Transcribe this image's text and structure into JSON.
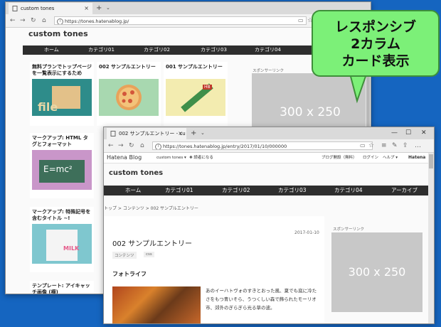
{
  "back_window": {
    "tab_title": "custom tones",
    "url": "https://tones.hatenablog.jp/",
    "blog_title": "custom tones",
    "menu": [
      "ホーム",
      "カテゴリ01",
      "カテゴリ02",
      "カテゴリ03",
      "カテゴリ04"
    ],
    "cards_row1": [
      {
        "title": "無料プランでトップページを一覧表示にするため",
        "thumb_text": "file"
      },
      {
        "title": "002 サンプルエントリー",
        "thumb_text": ""
      },
      {
        "title": "001 サンプルエントリー",
        "thumb_text": "HB"
      }
    ],
    "cards_col": [
      {
        "title": "マークアップ: HTML タグとフォーマット",
        "thumb_text": "E=mc²"
      },
      {
        "title": "マークアップ: 特殊記号を含むタイトル ~!",
        "thumb_text": "MILK"
      },
      {
        "title": "テンプレート: アイキャッチ画像 (横)",
        "thumb_text": ""
      }
    ],
    "sponsor_label": "スポンサーリンク",
    "ad_text": "300 x 250"
  },
  "front_window": {
    "tab_title": "002 サンプルエントリー - cu",
    "url": "https://tones.hatenablog.jp/entry/2017/01/10/000000",
    "hatena_logo": "Hatena Blog",
    "hatena_bar": {
      "blog_name": "custom tones ▾",
      "subscribe": "✚ 読者になる",
      "start_blog": "ブログ開設（無料）",
      "login": "ログイン",
      "help": "ヘルプ ▾",
      "hatena": "Hatena"
    },
    "blog_title": "custom tones",
    "menu": [
      "ホーム",
      "カテゴリ01",
      "カテゴリ02",
      "カテゴリ03",
      "カテゴリ04",
      "アーカイブ"
    ],
    "breadcrumb": "トップ  >  コンテンツ  >  002 サンプルエントリー",
    "entry_date": "2017-01-10",
    "entry_title": "002 サンプルエントリー",
    "tags": [
      "コンテンツ",
      "css"
    ],
    "section_heading": "フォトライフ",
    "body_text": "あのイーハトヴォのすきとおった風、夏でも底に冷たさをもつ青いそら、うつくしい森で飾られたモーリオ市、郊外のぎらぎら光る草の波。",
    "sponsor_label": "スポンサーリンク",
    "ad_text": "300 x 250"
  },
  "callout": {
    "line1": "レスポンシブ",
    "line2": "2カラム",
    "line3": "カード表示"
  },
  "colors": {
    "desktop": "#1565c0",
    "callout": "#7cf078",
    "menubar": "#2e2e2e"
  }
}
